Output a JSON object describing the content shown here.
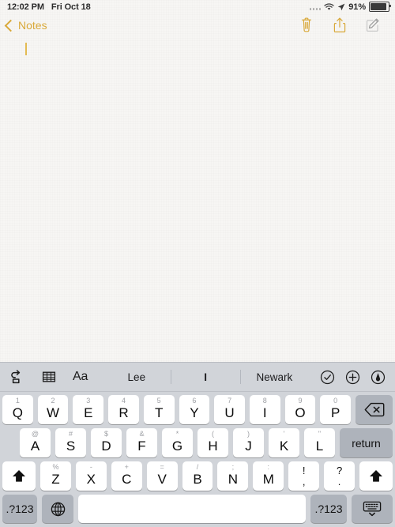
{
  "status_bar": {
    "time": "12:02 PM",
    "date": "Fri Oct 18",
    "battery_percent": "91%",
    "battery_level": 91,
    "icons": [
      "signal-dots-icon",
      "wifi-icon",
      "location-arrow-icon",
      "battery-icon"
    ]
  },
  "nav_bar": {
    "back_label": "Notes",
    "back_icon": "chevron-left-icon",
    "actions": [
      {
        "name": "delete-note-button",
        "icon": "trash-icon"
      },
      {
        "name": "share-note-button",
        "icon": "share-icon"
      },
      {
        "name": "compose-note-button",
        "icon": "compose-icon"
      }
    ],
    "accent_color": "#d9a93a"
  },
  "note": {
    "body_text": "",
    "cursor_visible": true,
    "background_color": "#f7f6f4"
  },
  "keyboard": {
    "background_color": "#d1d4d9",
    "key_color": "#ffffff",
    "modifier_key_color": "#aeb3bb",
    "toolbar": {
      "left_icons": [
        {
          "name": "undo-icon",
          "label": "undo"
        },
        {
          "name": "table-icon",
          "label": "table"
        }
      ],
      "format_label": "Aa",
      "predictions": [
        {
          "text": "Lee",
          "bold": false
        },
        {
          "text": "I",
          "bold": true
        },
        {
          "text": "Newark",
          "bold": false
        }
      ],
      "right_icons": [
        {
          "name": "checklist-circle-icon",
          "label": "checklist"
        },
        {
          "name": "plus-circle-icon",
          "label": "add-attachment"
        },
        {
          "name": "markup-circle-icon",
          "label": "markup"
        }
      ]
    },
    "rows": [
      {
        "name": "keyboard-row-1",
        "keys": [
          {
            "main": "Q",
            "hint": "1"
          },
          {
            "main": "W",
            "hint": "2"
          },
          {
            "main": "E",
            "hint": "3"
          },
          {
            "main": "R",
            "hint": "4"
          },
          {
            "main": "T",
            "hint": "5"
          },
          {
            "main": "Y",
            "hint": "6"
          },
          {
            "main": "U",
            "hint": "7"
          },
          {
            "main": "I",
            "hint": "8"
          },
          {
            "main": "O",
            "hint": "9"
          },
          {
            "main": "P",
            "hint": "0"
          }
        ],
        "backspace": {
          "name": "backspace-key",
          "icon": "delete-left-icon"
        }
      },
      {
        "name": "keyboard-row-2",
        "keys": [
          {
            "main": "A",
            "hint": "@"
          },
          {
            "main": "S",
            "hint": "#"
          },
          {
            "main": "D",
            "hint": "$"
          },
          {
            "main": "F",
            "hint": "&"
          },
          {
            "main": "G",
            "hint": "*"
          },
          {
            "main": "H",
            "hint": "("
          },
          {
            "main": "J",
            "hint": ")"
          },
          {
            "main": "K",
            "hint": "'"
          },
          {
            "main": "L",
            "hint": "\""
          }
        ],
        "return": {
          "name": "return-key",
          "label": "return"
        }
      },
      {
        "name": "keyboard-row-3",
        "shift_left": {
          "name": "shift-left-key",
          "icon": "shift-arrow-icon"
        },
        "keys": [
          {
            "main": "Z",
            "hint": "%"
          },
          {
            "main": "X",
            "hint": "-"
          },
          {
            "main": "C",
            "hint": "+"
          },
          {
            "main": "V",
            "hint": "="
          },
          {
            "main": "B",
            "hint": "/"
          },
          {
            "main": "N",
            "hint": ";"
          },
          {
            "main": "M",
            "hint": ":"
          }
        ],
        "punct_keys": [
          {
            "upper": "!",
            "lower": ",",
            "name": "exclamation-comma-key"
          },
          {
            "upper": "?",
            "lower": ".",
            "name": "question-period-key"
          }
        ],
        "shift_right": {
          "name": "shift-right-key",
          "icon": "shift-arrow-icon"
        }
      },
      {
        "name": "keyboard-row-4",
        "num_left": {
          "name": "numbers-left-key",
          "label": ".?123"
        },
        "globe": {
          "name": "globe-key",
          "icon": "globe-icon"
        },
        "space": {
          "name": "space-key",
          "label": ""
        },
        "num_right": {
          "name": "numbers-right-key",
          "label": ".?123"
        },
        "dismiss": {
          "name": "dismiss-keyboard-key",
          "icon": "keyboard-down-icon"
        }
      }
    ]
  }
}
